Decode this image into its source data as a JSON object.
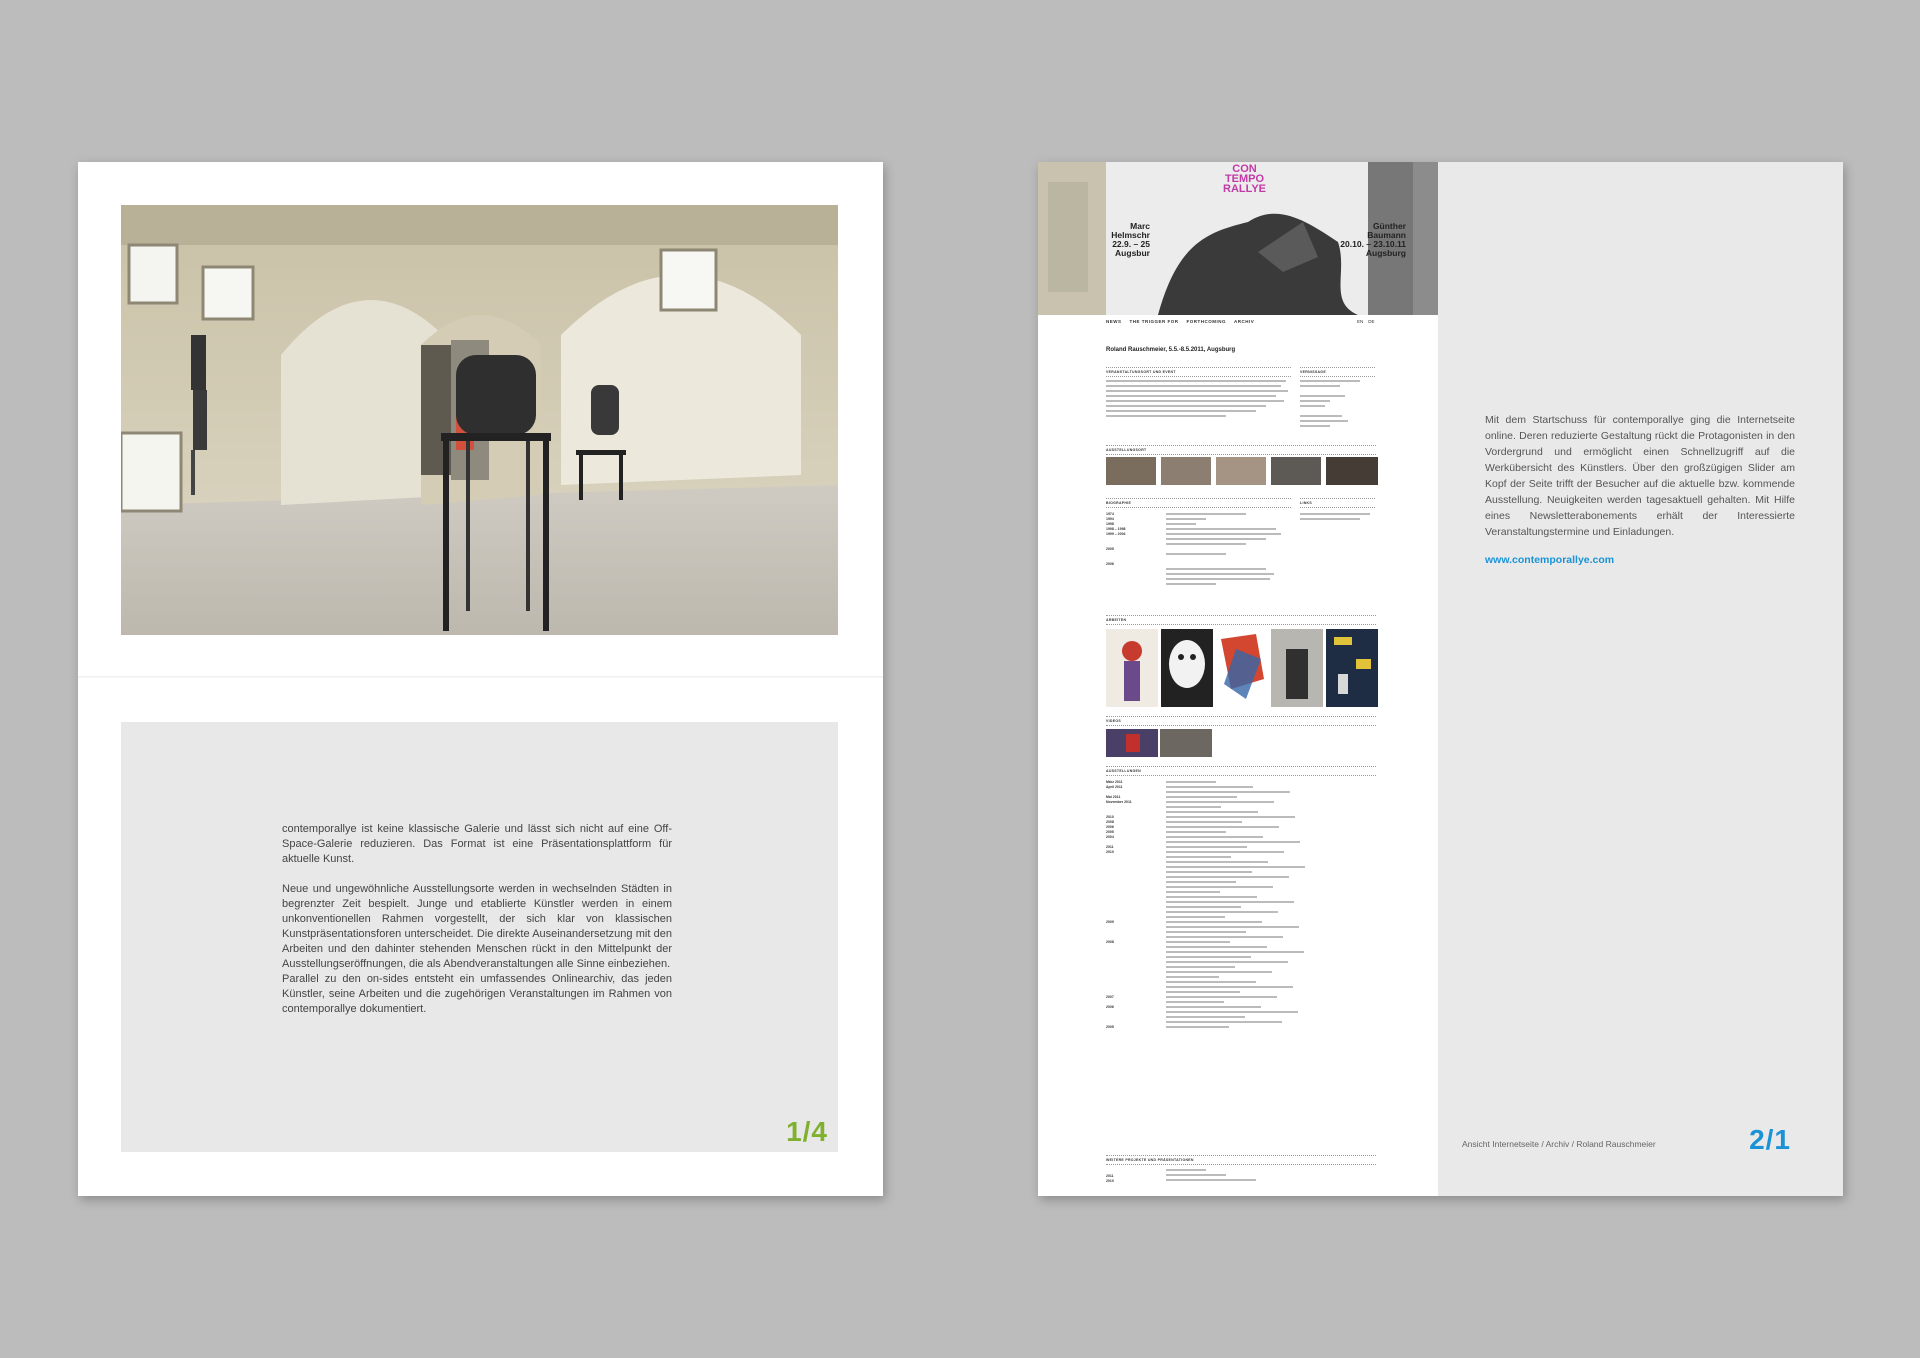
{
  "left_page": {
    "paragraphs": [
      "contemporallye ist keine klassische Galerie und lässt sich nicht auf eine Off-Space-Galerie reduzieren. Das Format ist eine Präsentationsplattform für aktuelle Kunst.",
      "Neue und ungewöhnliche Ausstellungsorte werden in wechselnden Städten in begrenzter Zeit bespielt. Junge und etablierte Künstler werden in einem unkonventionellen Rahmen vorgestellt, der sich klar von klassischen Kunstpräsentationsforen unterscheidet. Die direkte Auseinandersetzung mit den Arbeiten und den dahinter stehenden Menschen rückt in den Mittelpunkt der Ausstellungseröffnungen, die als Abendveranstaltungen alle Sinne einbeziehen.",
      "Parallel zu den on-sides entsteht ein umfassendes Onlinearchiv, das jeden Künstler, seine Arbeiten und die zugehörigen Veranstaltungen im Rahmen von contemporallye dokumentiert."
    ],
    "page_number": "1/4",
    "accent_color": "#7fb02e"
  },
  "right_page": {
    "text": "Mit dem Startschuss für contemporallye ging die Internetseite online. Deren reduzierte Gestaltung rückt die Protagonisten in den Vordergrund und ermöglicht einen Schnellzugriff auf die Werkübersicht des Künstlers. Über den großzügigen Slider am Kopf der Seite trifft der Besucher auf die aktuelle bzw. kommende Ausstellung. Neuigkeiten werden tagesaktuell gehalten. Mit Hilfe eines Newsletterabonements erhält der Interessierte Veranstaltungstermine und Einladungen.",
    "url": "www.contemporallye.com",
    "caption": "Ansicht Internetseite / Archiv / Roland Rauschmeier",
    "page_number": "2/1",
    "accent_color": "#1a93d6"
  },
  "website": {
    "logo_lines": [
      "CON",
      "TEMPO",
      "RALLYE"
    ],
    "logo_color": "#c23aa6",
    "banner_left_artist": [
      "Marc",
      "Helmschr",
      "22.9. – 25",
      "Augsbur"
    ],
    "banner_right_artist": [
      "Günther",
      "Baumann",
      "20.10. – 23.10.11",
      "Augsburg"
    ],
    "nav": [
      "NEWS",
      "THE TRIGGER FOR",
      "FORTHCOMING",
      "ARCHIV"
    ],
    "lang": [
      "EN",
      "DE"
    ],
    "title": "Roland Rauschmeier, 5.5.-8.5.2011, Augsburg",
    "sections": {
      "event": "VERANSTALTUNGSORT UND EVENT",
      "vernissage": "VERNISSAGE",
      "exhibition_view": "AUSSTELLUNGSORT",
      "biography": "BIOGRAPHIE",
      "links": "LINKS",
      "works": "ARBEITEN",
      "videos": "VIDEOS",
      "exhibitions": "AUSSTELLUNGEN",
      "further": "WEITERE PROJEKTE UND PRÄSENTATIONEN"
    },
    "bio_years": [
      "1974",
      "1994",
      "1998",
      "1998 – 1998",
      "1999 – 2004",
      "",
      "2005",
      "",
      "2006"
    ],
    "exhibition_years": [
      "März 2011",
      "April 2011",
      "",
      "Mai 2011",
      "November 2011",
      "",
      "",
      "2010",
      "2008",
      "2006",
      "2005",
      "2004",
      "",
      "2011",
      "2010",
      "",
      "",
      "",
      "",
      "",
      "",
      "",
      "",
      "",
      "",
      "",
      "",
      "",
      "2009",
      "",
      "",
      "",
      "2008",
      "",
      "",
      "",
      "",
      "",
      "",
      "",
      "",
      "",
      "",
      "2007",
      "",
      "2006",
      "",
      "",
      "",
      "2005"
    ],
    "further_years": [
      "2011",
      "2010"
    ]
  }
}
